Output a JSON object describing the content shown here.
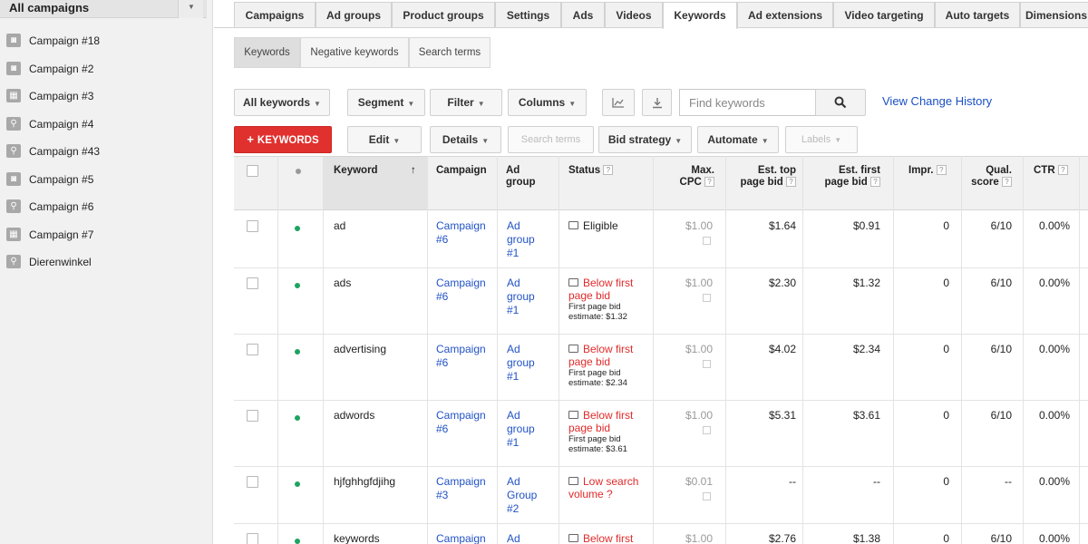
{
  "sidebar": {
    "title": "All campaigns",
    "items": [
      {
        "label": "Campaign #18",
        "icon": "display-campaign-icon"
      },
      {
        "label": "Campaign #2",
        "icon": "display-campaign-icon"
      },
      {
        "label": "Campaign #3",
        "icon": "shopping-campaign-icon"
      },
      {
        "label": "Campaign #4",
        "icon": "search-campaign-icon"
      },
      {
        "label": "Campaign #43",
        "icon": "search-campaign-icon"
      },
      {
        "label": "Campaign #5",
        "icon": "display-campaign-icon"
      },
      {
        "label": "Campaign #6",
        "icon": "search-campaign-icon"
      },
      {
        "label": "Campaign #7",
        "icon": "shopping-campaign-icon"
      },
      {
        "label": "Dierenwinkel",
        "icon": "search-campaign-icon"
      }
    ]
  },
  "tabs": [
    "Campaigns",
    "Ad groups",
    "Product groups",
    "Settings",
    "Ads",
    "Videos",
    "Keywords",
    "Ad extensions",
    "Video targeting",
    "Auto targets",
    "Dimensions"
  ],
  "active_tab": "Keywords",
  "subtabs": [
    "Keywords",
    "Negative keywords",
    "Search terms"
  ],
  "toolbar": {
    "all_keywords": "All keywords",
    "segment": "Segment",
    "filter": "Filter",
    "columns": "Columns",
    "search_placeholder": "Find keywords",
    "view_history": "View Change History",
    "add_keywords": "KEYWORDS",
    "edit": "Edit",
    "details": "Details",
    "search_terms": "Search terms",
    "bid_strategy": "Bid strategy",
    "automate": "Automate",
    "labels": "Labels"
  },
  "table": {
    "headers": {
      "keyword": "Keyword",
      "campaign": "Campaign",
      "ad_group": [
        "Ad",
        "group"
      ],
      "status": "Status",
      "max_cpc": [
        "Max.",
        "CPC"
      ],
      "est_top": [
        "Est. top",
        "page bid"
      ],
      "est_first": [
        "Est. first",
        "page bid"
      ],
      "impr": "Impr.",
      "qual": [
        "Qual.",
        "score"
      ],
      "ctr": "CTR"
    },
    "rows": [
      {
        "keyword": "ad",
        "campaign": [
          "Campaign",
          "#6"
        ],
        "ad_group": [
          "Ad",
          "group",
          "#1"
        ],
        "status": [
          "Eligible"
        ],
        "status_detail": [],
        "max_cpc": "$1.00",
        "est_top": "$1.64",
        "est_first": "$0.91",
        "impr": "0",
        "qual": "6/10",
        "ctr": "0.00%"
      },
      {
        "keyword": "ads",
        "campaign": [
          "Campaign",
          "#6"
        ],
        "ad_group": [
          "Ad",
          "group",
          "#1"
        ],
        "status": [
          "Below first",
          "page bid"
        ],
        "status_detail": [
          "First page bid",
          "estimate: $1.32"
        ],
        "max_cpc": "$1.00",
        "est_top": "$2.30",
        "est_first": "$1.32",
        "impr": "0",
        "qual": "6/10",
        "ctr": "0.00%"
      },
      {
        "keyword": "advertising",
        "campaign": [
          "Campaign",
          "#6"
        ],
        "ad_group": [
          "Ad",
          "group",
          "#1"
        ],
        "status": [
          "Below first",
          "page bid"
        ],
        "status_detail": [
          "First page bid",
          "estimate: $2.34"
        ],
        "max_cpc": "$1.00",
        "est_top": "$4.02",
        "est_first": "$2.34",
        "impr": "0",
        "qual": "6/10",
        "ctr": "0.00%"
      },
      {
        "keyword": "adwords",
        "campaign": [
          "Campaign",
          "#6"
        ],
        "ad_group": [
          "Ad",
          "group",
          "#1"
        ],
        "status": [
          "Below first",
          "page bid"
        ],
        "status_detail": [
          "First page bid",
          "estimate: $3.61"
        ],
        "max_cpc": "$1.00",
        "est_top": "$5.31",
        "est_first": "$3.61",
        "impr": "0",
        "qual": "6/10",
        "ctr": "0.00%"
      },
      {
        "keyword": "hjfghhgfdjihg",
        "campaign": [
          "Campaign",
          "#3"
        ],
        "ad_group": [
          "Ad",
          "Group",
          "#2"
        ],
        "status": [
          "Low search",
          "volume"
        ],
        "status_detail": [],
        "max_cpc": "$0.01",
        "est_top": "--",
        "est_first": "--",
        "impr": "0",
        "qual": "--",
        "ctr": "0.00%"
      },
      {
        "keyword": "keywords",
        "campaign": [
          "Campaign"
        ],
        "ad_group": [
          "Ad"
        ],
        "status": [
          "Below first"
        ],
        "status_detail": [],
        "max_cpc": "$1.00",
        "est_top": "$2.76",
        "est_first": "$1.38",
        "impr": "0",
        "qual": "6/10",
        "ctr": "0.00%"
      }
    ]
  }
}
